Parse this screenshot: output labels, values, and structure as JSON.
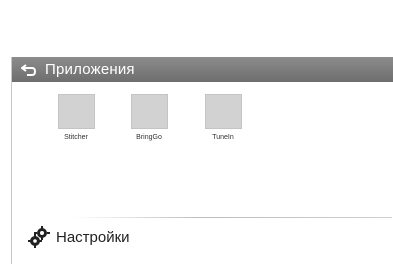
{
  "header": {
    "title": "Приложения",
    "back_icon": "back-arrow-icon"
  },
  "apps": [
    {
      "label": "Stitcher"
    },
    {
      "label": "BringGo"
    },
    {
      "label": "TuneIn"
    }
  ],
  "settings": {
    "label": "Настройки",
    "icon": "gear-icon"
  },
  "colors": {
    "header_bg": "#7a7a7a",
    "tile_bg": "#d2d2d2"
  }
}
